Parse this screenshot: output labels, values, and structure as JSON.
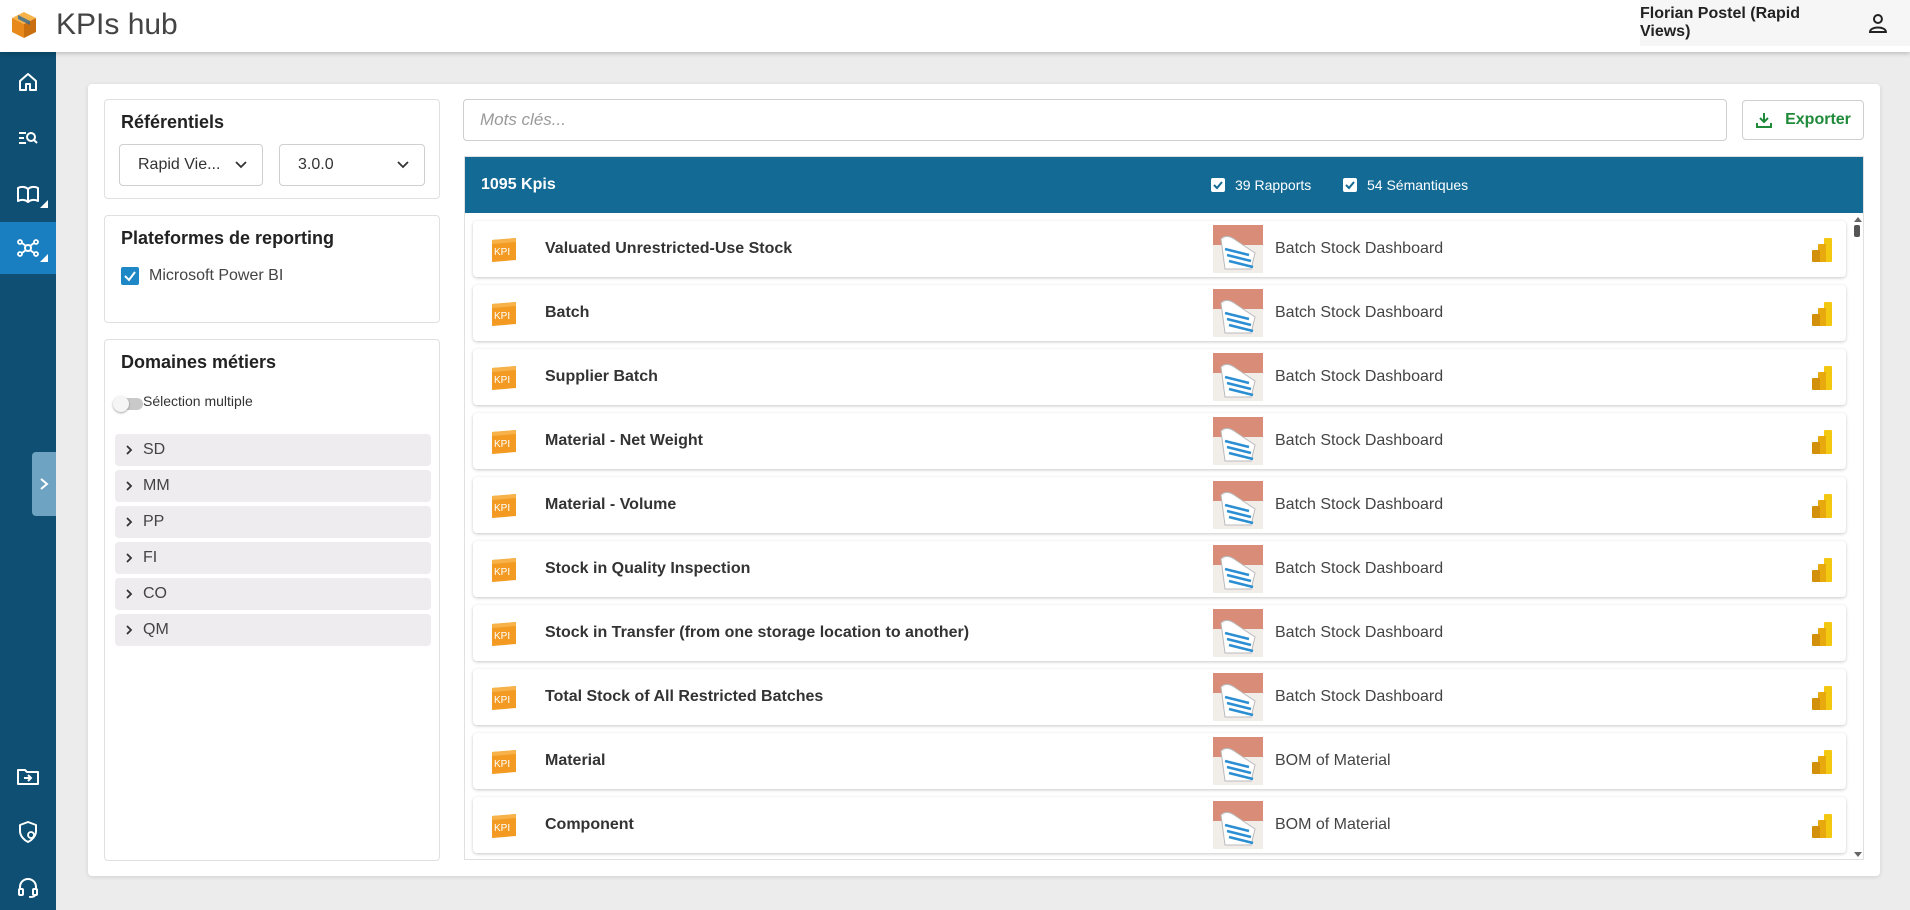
{
  "header": {
    "title": "KPIs hub",
    "user_name": "Florian Postel (Rapid Views)"
  },
  "sidebar": {
    "top_items": [
      {
        "name": "home-icon"
      },
      {
        "name": "search-list-icon"
      },
      {
        "name": "book-icon"
      },
      {
        "name": "network-icon",
        "active": true
      }
    ],
    "bottom_items": [
      {
        "name": "import-folder-icon"
      },
      {
        "name": "shield-settings-icon"
      },
      {
        "name": "support-headset-icon"
      }
    ]
  },
  "referentiels": {
    "title": "Référentiels",
    "source_select": "Rapid Vie...",
    "version_select": "3.0.0"
  },
  "plateformes": {
    "title": "Plateformes de reporting",
    "items": [
      {
        "label": "Microsoft Power BI",
        "checked": true
      }
    ]
  },
  "domaines": {
    "title": "Domaines métiers",
    "multi_select_label": "Sélection multiple",
    "items": [
      "SD",
      "MM",
      "PP",
      "FI",
      "CO",
      "QM"
    ]
  },
  "search": {
    "placeholder": "Mots clés..."
  },
  "export_label": "Exporter",
  "results": {
    "kpi_count": "1095 Kpis",
    "reports_filter": "39 Rapports",
    "semantics_filter": "54 Sémantiques",
    "rows": [
      {
        "kpi": "Valuated Unrestricted-Use Stock",
        "report": "Batch Stock Dashboard"
      },
      {
        "kpi": "Batch",
        "report": "Batch Stock Dashboard"
      },
      {
        "kpi": "Supplier Batch",
        "report": "Batch Stock Dashboard"
      },
      {
        "kpi": "Material - Net Weight",
        "report": "Batch Stock Dashboard"
      },
      {
        "kpi": "Material - Volume",
        "report": "Batch Stock Dashboard"
      },
      {
        "kpi": "Stock in Quality Inspection",
        "report": "Batch Stock Dashboard"
      },
      {
        "kpi": "Stock in Transfer (from one storage location to another)",
        "report": "Batch Stock Dashboard"
      },
      {
        "kpi": "Total Stock of All Restricted Batches",
        "report": "Batch Stock Dashboard"
      },
      {
        "kpi": "Material",
        "report": "BOM of Material"
      },
      {
        "kpi": "Component",
        "report": "BOM of Material"
      }
    ]
  },
  "colors": {
    "sidebar": "#0e4f73",
    "sidebar_active": "#1a7fc0",
    "results_header": "#126a95",
    "export_green": "#1f8a3a",
    "kpi_orange": "#f39a22",
    "powerbi_yellow": "#f2c811"
  }
}
